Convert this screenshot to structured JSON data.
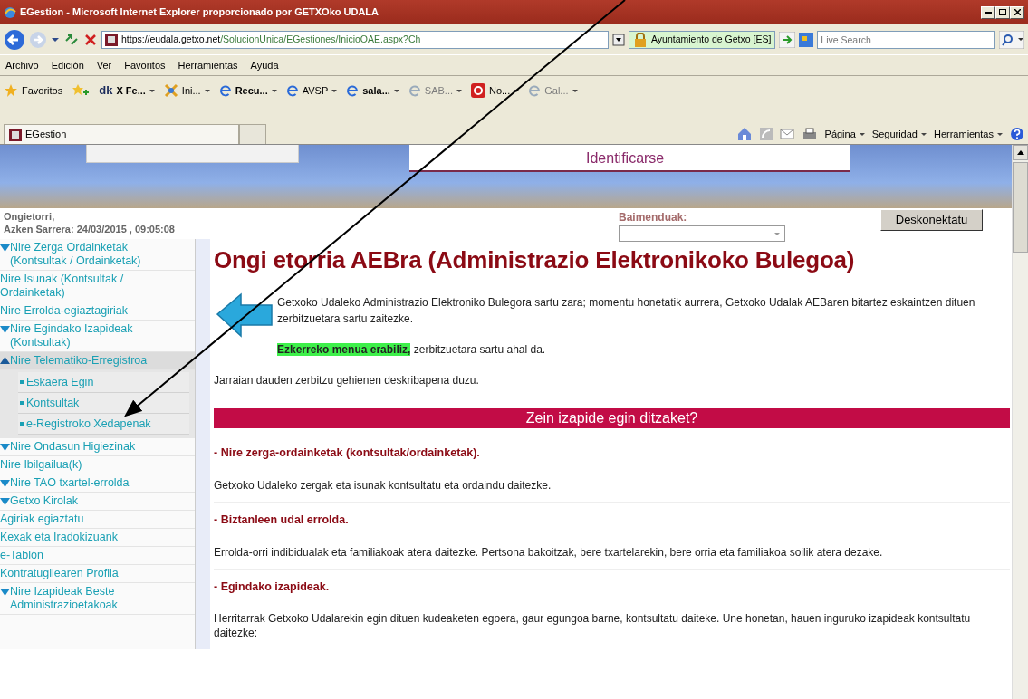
{
  "window": {
    "title": "EGestion - Microsoft Internet Explorer proporcionado por GETXOko UDALA"
  },
  "address_bar": {
    "url_host": "https://eudala.getxo.net",
    "url_path": "/SolucionUnica/EGestiones/InicioOAE.aspx?Ch",
    "security_label": "Ayuntamiento de Getxo [ES]",
    "search_placeholder": "Live Search"
  },
  "menu": [
    "Archivo",
    "Edición",
    "Ver",
    "Favoritos",
    "Herramientas",
    "Ayuda"
  ],
  "favorites": {
    "label": "Favoritos",
    "items": [
      {
        "label": "X Fe...",
        "icon_text": "dk",
        "kind": "bold"
      },
      {
        "label": "Ini...",
        "kind": "normal"
      },
      {
        "label": "Recu...",
        "kind": "bold"
      },
      {
        "label": "AVSP",
        "kind": "normal"
      },
      {
        "label": "sala...",
        "kind": "bold"
      },
      {
        "label": "SAB...",
        "kind": "dim"
      },
      {
        "label": "No...",
        "kind": "normal"
      },
      {
        "label": "Gal...",
        "kind": "dim"
      }
    ]
  },
  "tab": {
    "title": "EGestion"
  },
  "command_bar": [
    "Página",
    "Seguridad",
    "Herramientas"
  ],
  "header": {
    "login_link": "Identificarse",
    "welcome": "Ongietorri,",
    "last_login": "Azken Sarrera: 24/03/2015 , 09:05:08",
    "permissions_label": "Baimenduak:",
    "disconnect_button": "Deskonektatu"
  },
  "sidebar": [
    {
      "label": "Nire Zerga Ordainketak (Kontsultak / Ordainketak)",
      "kind": "group",
      "expanded": false
    },
    {
      "label": "Nire Isunak (Kontsultak / Ordainketak)",
      "kind": "link"
    },
    {
      "label": "Nire Errolda-egiaztagiriak",
      "kind": "link"
    },
    {
      "label": "Nire Egindako Izapideak (Kontsultak)",
      "kind": "group",
      "expanded": false
    },
    {
      "label": "Nire Telematiko-Erregistroa",
      "kind": "group",
      "expanded": true,
      "children": [
        {
          "label": "Eskaera Egin"
        },
        {
          "label": "Kontsultak"
        },
        {
          "label": "e-Registroko Xedapenak"
        }
      ]
    },
    {
      "label": "Nire Ondasun Higiezinak",
      "kind": "group",
      "expanded": false
    },
    {
      "label": "Nire Ibilgailua(k)",
      "kind": "link"
    },
    {
      "label": "Nire TAO txartel-errolda",
      "kind": "group",
      "expanded": false
    },
    {
      "label": "Getxo Kirolak",
      "kind": "group",
      "expanded": false
    },
    {
      "label": "Agiriak egiaztatu",
      "kind": "link"
    },
    {
      "label": "Kexak eta Iradokizuank",
      "kind": "link"
    },
    {
      "label": "e-Tablón",
      "kind": "link"
    },
    {
      "label": "Kontratugilearen Profila",
      "kind": "link"
    },
    {
      "label": "Nire Izapideak Beste Administrazioetakoak",
      "kind": "group",
      "expanded": false
    }
  ],
  "main": {
    "title": "Ongi etorria AEBra (Administrazio Elektronikoko Bulegoa)",
    "intro": "Getxoko Udaleko Administrazio Elektroniko Bulegora sartu zara; momentu honetatik aurrera, Getxoko Udalak AEBaren bitartez eskaintzen dituen zerbitzuetara sartu zaitezke.",
    "hint_highlight": "Ezkerreko menua erabiliz,",
    "hint_rest": " zerbitzuetara sartu ahal da.",
    "description": "Jarraian dauden zerbitzu gehienen deskribapena duzu.",
    "section_bar": "Zein izapide egin ditzaket?",
    "sections": [
      {
        "heading": "- Nire zerga-ordainketak (kontsultak/ordainketak).",
        "text": "Getxoko Udaleko zergak eta isunak kontsultatu eta ordaindu daitezke."
      },
      {
        "heading": "- Biztanleen udal errolda.",
        "text": "Errolda-orri indibidualak eta familiakoak atera daitezke. Pertsona bakoitzak, bere txartelarekin, bere orria eta familiakoa soilik atera dezake."
      },
      {
        "heading": "- Egindako izapideak.",
        "text": "Herritarrak Getxoko Udalarekin egin dituen kudeaketen egoera, gaur egungoa barne, kontsultatu daiteke. Une honetan, hauen inguruko izapideak kontsultatu daitezke:"
      }
    ]
  }
}
